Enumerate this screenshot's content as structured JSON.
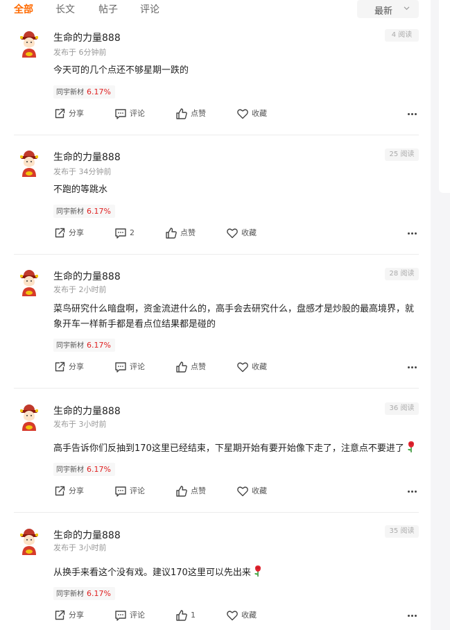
{
  "tabs": [
    {
      "label": "全部",
      "active": true
    },
    {
      "label": "长文",
      "active": false
    },
    {
      "label": "帖子",
      "active": false
    },
    {
      "label": "评论",
      "active": false
    }
  ],
  "sort": {
    "label": "最新",
    "icon": "chevron-down-icon"
  },
  "colors": {
    "accent": "#ff6a00",
    "up": "#e02020"
  },
  "posts": [
    {
      "user": "生命的力量888",
      "time": "发布于 6分钟前",
      "reads": "4 阅读",
      "content": "今天可的几个点还不够星期一跌的",
      "stock_name": "同宇新材",
      "stock_change": "6.17%",
      "share": "分享",
      "comment": "评论",
      "like": "点赞",
      "fav": "收藏"
    },
    {
      "user": "生命的力量888",
      "time": "发布于 34分钟前",
      "reads": "25 阅读",
      "content": "不跑的等跳水",
      "stock_name": "同宇新材",
      "stock_change": "6.17%",
      "share": "分享",
      "comment": "2",
      "like": "点赞",
      "fav": "收藏"
    },
    {
      "user": "生命的力量888",
      "time": "发布于 2小时前",
      "reads": "28 阅读",
      "content": "菜鸟研究什么暗盘啊，资金流进什么的，高手会去研究什么，盘感才是炒股的最高境界，就象开车一样新手都是看点位结果都是碰的",
      "stock_name": "同宇新材",
      "stock_change": "6.17%",
      "share": "分享",
      "comment": "评论",
      "like": "点赞",
      "fav": "收藏"
    },
    {
      "user": "生命的力量888",
      "time": "发布于 3小时前",
      "reads": "36 阅读",
      "content": "高手告诉你们反抽到170这里已经结束，下星期开始有要开始像下走了，注意点不要进了",
      "stock_name": "同宇新材",
      "stock_change": "6.17%",
      "share": "分享",
      "comment": "评论",
      "like": "点赞",
      "fav": "收藏"
    },
    {
      "user": "生命的力量888",
      "time": "发布于 3小时前",
      "reads": "35 阅读",
      "content": "从换手来看这个没有戏。建议170这里可以先出来",
      "stock_name": "同宇新材",
      "stock_change": "6.17%",
      "share": "分享",
      "comment": "评论",
      "like": "1",
      "fav": "收藏"
    }
  ]
}
